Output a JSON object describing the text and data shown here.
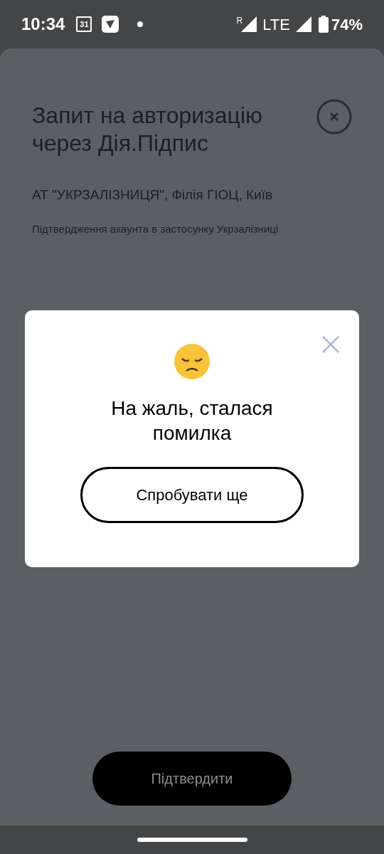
{
  "status_bar": {
    "time": "10:34",
    "calendar_day": "31",
    "roaming": "R",
    "network": "LTE",
    "battery": "74%"
  },
  "sheet": {
    "title": "Запит на авторизацію через Дія.Підпис",
    "organization": "АТ \"УКРЗАЛІЗНИЦЯ\", Філія ГІОЦ, Київ",
    "description": "Підтвердження акаунта в застосунку Укрзалізниці",
    "confirm_button": "Підтвердити"
  },
  "dialog": {
    "title": "На жаль, сталася помилка",
    "retry_button": "Спробувати ще"
  }
}
